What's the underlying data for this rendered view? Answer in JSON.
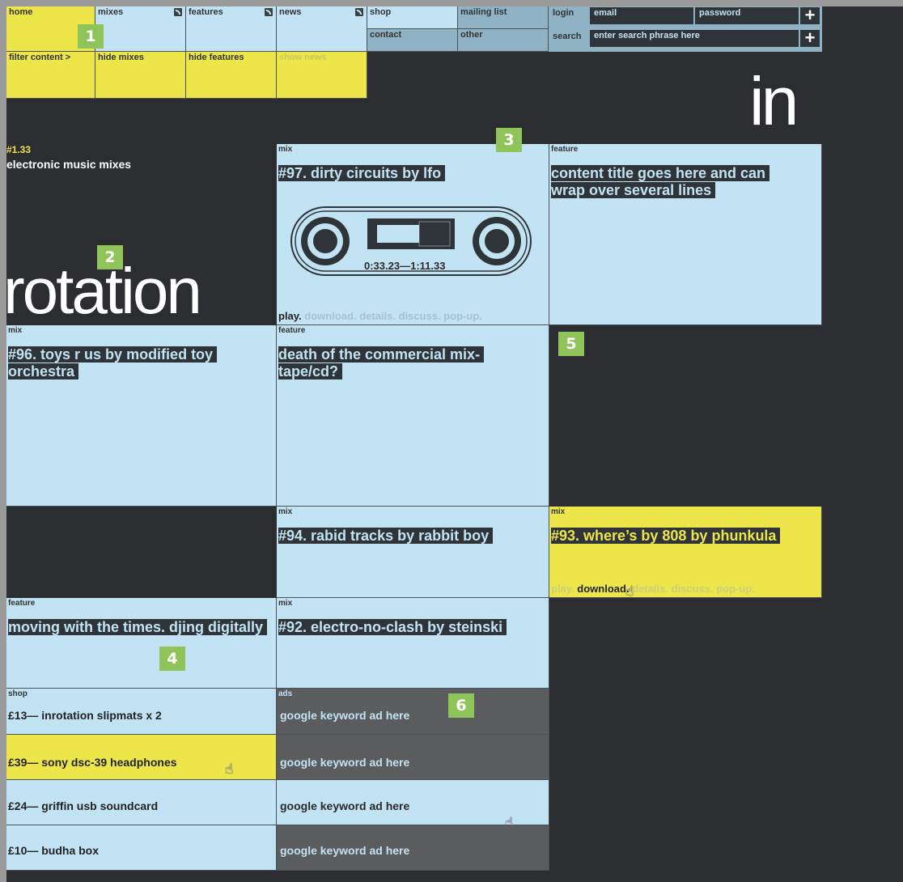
{
  "nav": {
    "home": "home",
    "mixes": "mixes",
    "features": "features",
    "news": "news",
    "shop": "shop",
    "mailing_list": "mailing list",
    "contact": "contact",
    "other": "other",
    "filter_content": "filter content >",
    "hide_mixes": "hide mixes",
    "hide_features": "hide features",
    "show_news": "show news"
  },
  "login": {
    "label": "login",
    "email_placeholder": "email",
    "password_placeholder": "password",
    "submit": "+"
  },
  "search": {
    "label": "search",
    "placeholder": "enter search phrase here",
    "submit": "+"
  },
  "brand": {
    "issue": "#1.33",
    "tagline": "electronic music mixes",
    "logo_left": "rotation",
    "logo_top": "in"
  },
  "tiles": {
    "mix97": {
      "tag": "mix",
      "title": "#97. dirty circuits by lfo",
      "timecode": "0:33.23—1:11.33",
      "actions": [
        "play.",
        "download.",
        "details.",
        "discuss.",
        "pop-up."
      ]
    },
    "feature_title": {
      "tag": "feature",
      "title": "content title goes here and can wrap over several lines"
    },
    "mix96": {
      "tag": "mix",
      "title": "#96. toys r us by modified toy orchestra"
    },
    "feature_death": {
      "tag": "feature",
      "title": "death of the commercial mix-tape/cd?"
    },
    "mix94": {
      "tag": "mix",
      "title": "#94. rabid tracks by rabbit boy"
    },
    "mix93": {
      "tag": "mix",
      "title": "#93. where’s by 808 by phunkula",
      "actions": [
        "play.",
        "download.",
        "details.",
        "discuss.",
        "pop-up."
      ]
    },
    "feature_moving": {
      "tag": "feature",
      "title": "moving with the times. djing digitally"
    },
    "mix92": {
      "tag": "mix",
      "title": "#92. electro-no-clash by steinski"
    }
  },
  "shop": {
    "tag": "shop",
    "items": [
      "£13— inrotation slipmats x 2",
      "£39— sony dsc-39 headphones",
      "£24— griffin usb soundcard",
      "£10— budha box"
    ]
  },
  "ads": {
    "tag": "ads",
    "items": [
      "google keyword ad here",
      "google keyword ad here",
      "google keyword ad here",
      "google keyword ad here"
    ]
  },
  "badges": [
    "1",
    "2",
    "3",
    "4",
    "5",
    "6"
  ],
  "colors": {
    "background": "#2b2d30",
    "tile_blue": "#c2e3f3",
    "highlight_yellow": "#ede64a",
    "badge_green": "#8fc45b"
  }
}
